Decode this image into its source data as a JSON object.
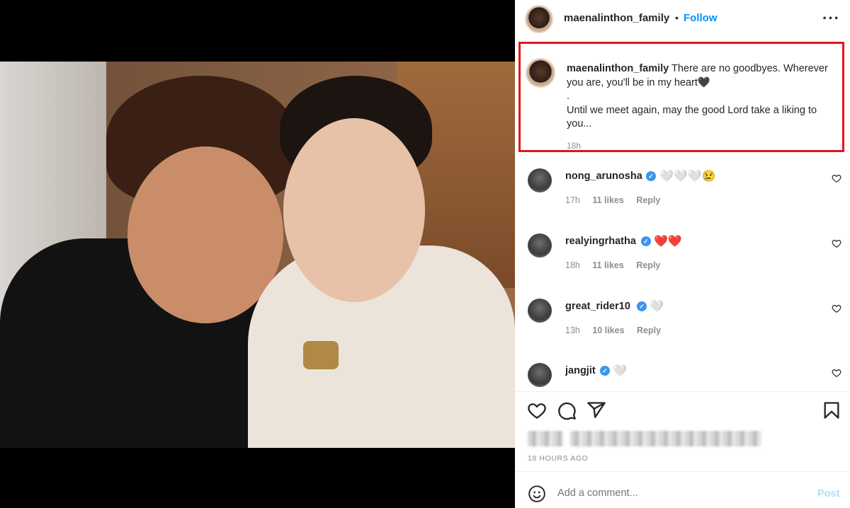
{
  "post": {
    "author": "maenalinthon_family",
    "dot": "•",
    "follow_label": "Follow",
    "more_label": "···",
    "caption_line1": " There are no goodbyes. Wherever you are, you'll be in my heart🖤",
    "caption_line2": ".",
    "caption_line3": "Until we meet again, may the good Lord take a liking to you...",
    "caption_time": "18h",
    "time_ago": "18 HOURS AGO",
    "comment_placeholder": "Add a comment...",
    "post_label": "Post"
  },
  "comments": [
    {
      "user": "nong_arunosha",
      "verified": true,
      "text": "🤍🤍🤍😢",
      "time": "17h",
      "likes": "11 likes",
      "reply": "Reply"
    },
    {
      "user": "realyingrhatha",
      "verified": true,
      "text": "❤️❤️",
      "time": "18h",
      "likes": "11 likes",
      "reply": "Reply"
    },
    {
      "user": "great_rider10",
      "verified": true,
      "text": "🤍",
      "time": "13h",
      "likes": "10 likes",
      "reply": "Reply"
    },
    {
      "user": "jangjit",
      "verified": true,
      "text": "🤍"
    }
  ],
  "colors": {
    "accent": "#0095f6",
    "highlight_box": "#e0161b",
    "verified": "#3897f0",
    "muted": "#8e8e8e"
  },
  "icons": [
    "heart-icon",
    "comment-icon",
    "share-icon",
    "bookmark-icon",
    "emoji-icon",
    "verified-icon",
    "more-icon"
  ]
}
